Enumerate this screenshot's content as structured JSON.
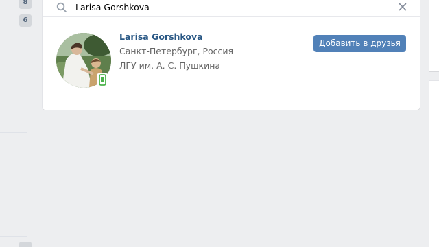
{
  "sidebar": {
    "badges": [
      "8",
      "6"
    ]
  },
  "search": {
    "query": "Larisa Gorshkova",
    "search_icon": "search-icon",
    "clear_icon": "close-icon"
  },
  "result": {
    "name": "Larisa Gorshkova",
    "location": "Санкт-Петербург, Россия",
    "education": "ЛГУ им. А. С. Пушкина",
    "online_indicator": "mobile-icon",
    "action_label": "Добавить в друзья"
  },
  "colors": {
    "background": "#edeef0",
    "link": "#2a5885",
    "button": "#5181b8",
    "online_mobile": "#4bb34b"
  }
}
